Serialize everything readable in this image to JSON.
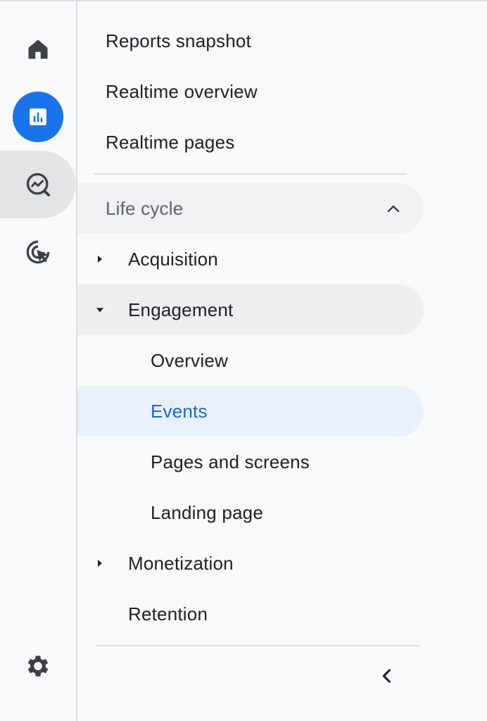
{
  "rail": {
    "items": [
      {
        "icon": "home-icon"
      },
      {
        "icon": "reports-icon"
      },
      {
        "icon": "explore-icon"
      },
      {
        "icon": "advertising-icon"
      }
    ],
    "settings_icon": "gear-icon"
  },
  "nav": {
    "top_items": [
      "Reports snapshot",
      "Realtime overview",
      "Realtime pages"
    ],
    "section_title": "Life cycle",
    "acquisition": "Acquisition",
    "engagement": "Engagement",
    "engagement_children": [
      "Overview",
      "Events",
      "Pages and screens",
      "Landing page"
    ],
    "monetization": "Monetization",
    "retention": "Retention",
    "selected": "Events"
  },
  "colors": {
    "accent": "#1a73e8",
    "selected_bg": "#e8f0fe",
    "selected_text": "#1967d2"
  }
}
